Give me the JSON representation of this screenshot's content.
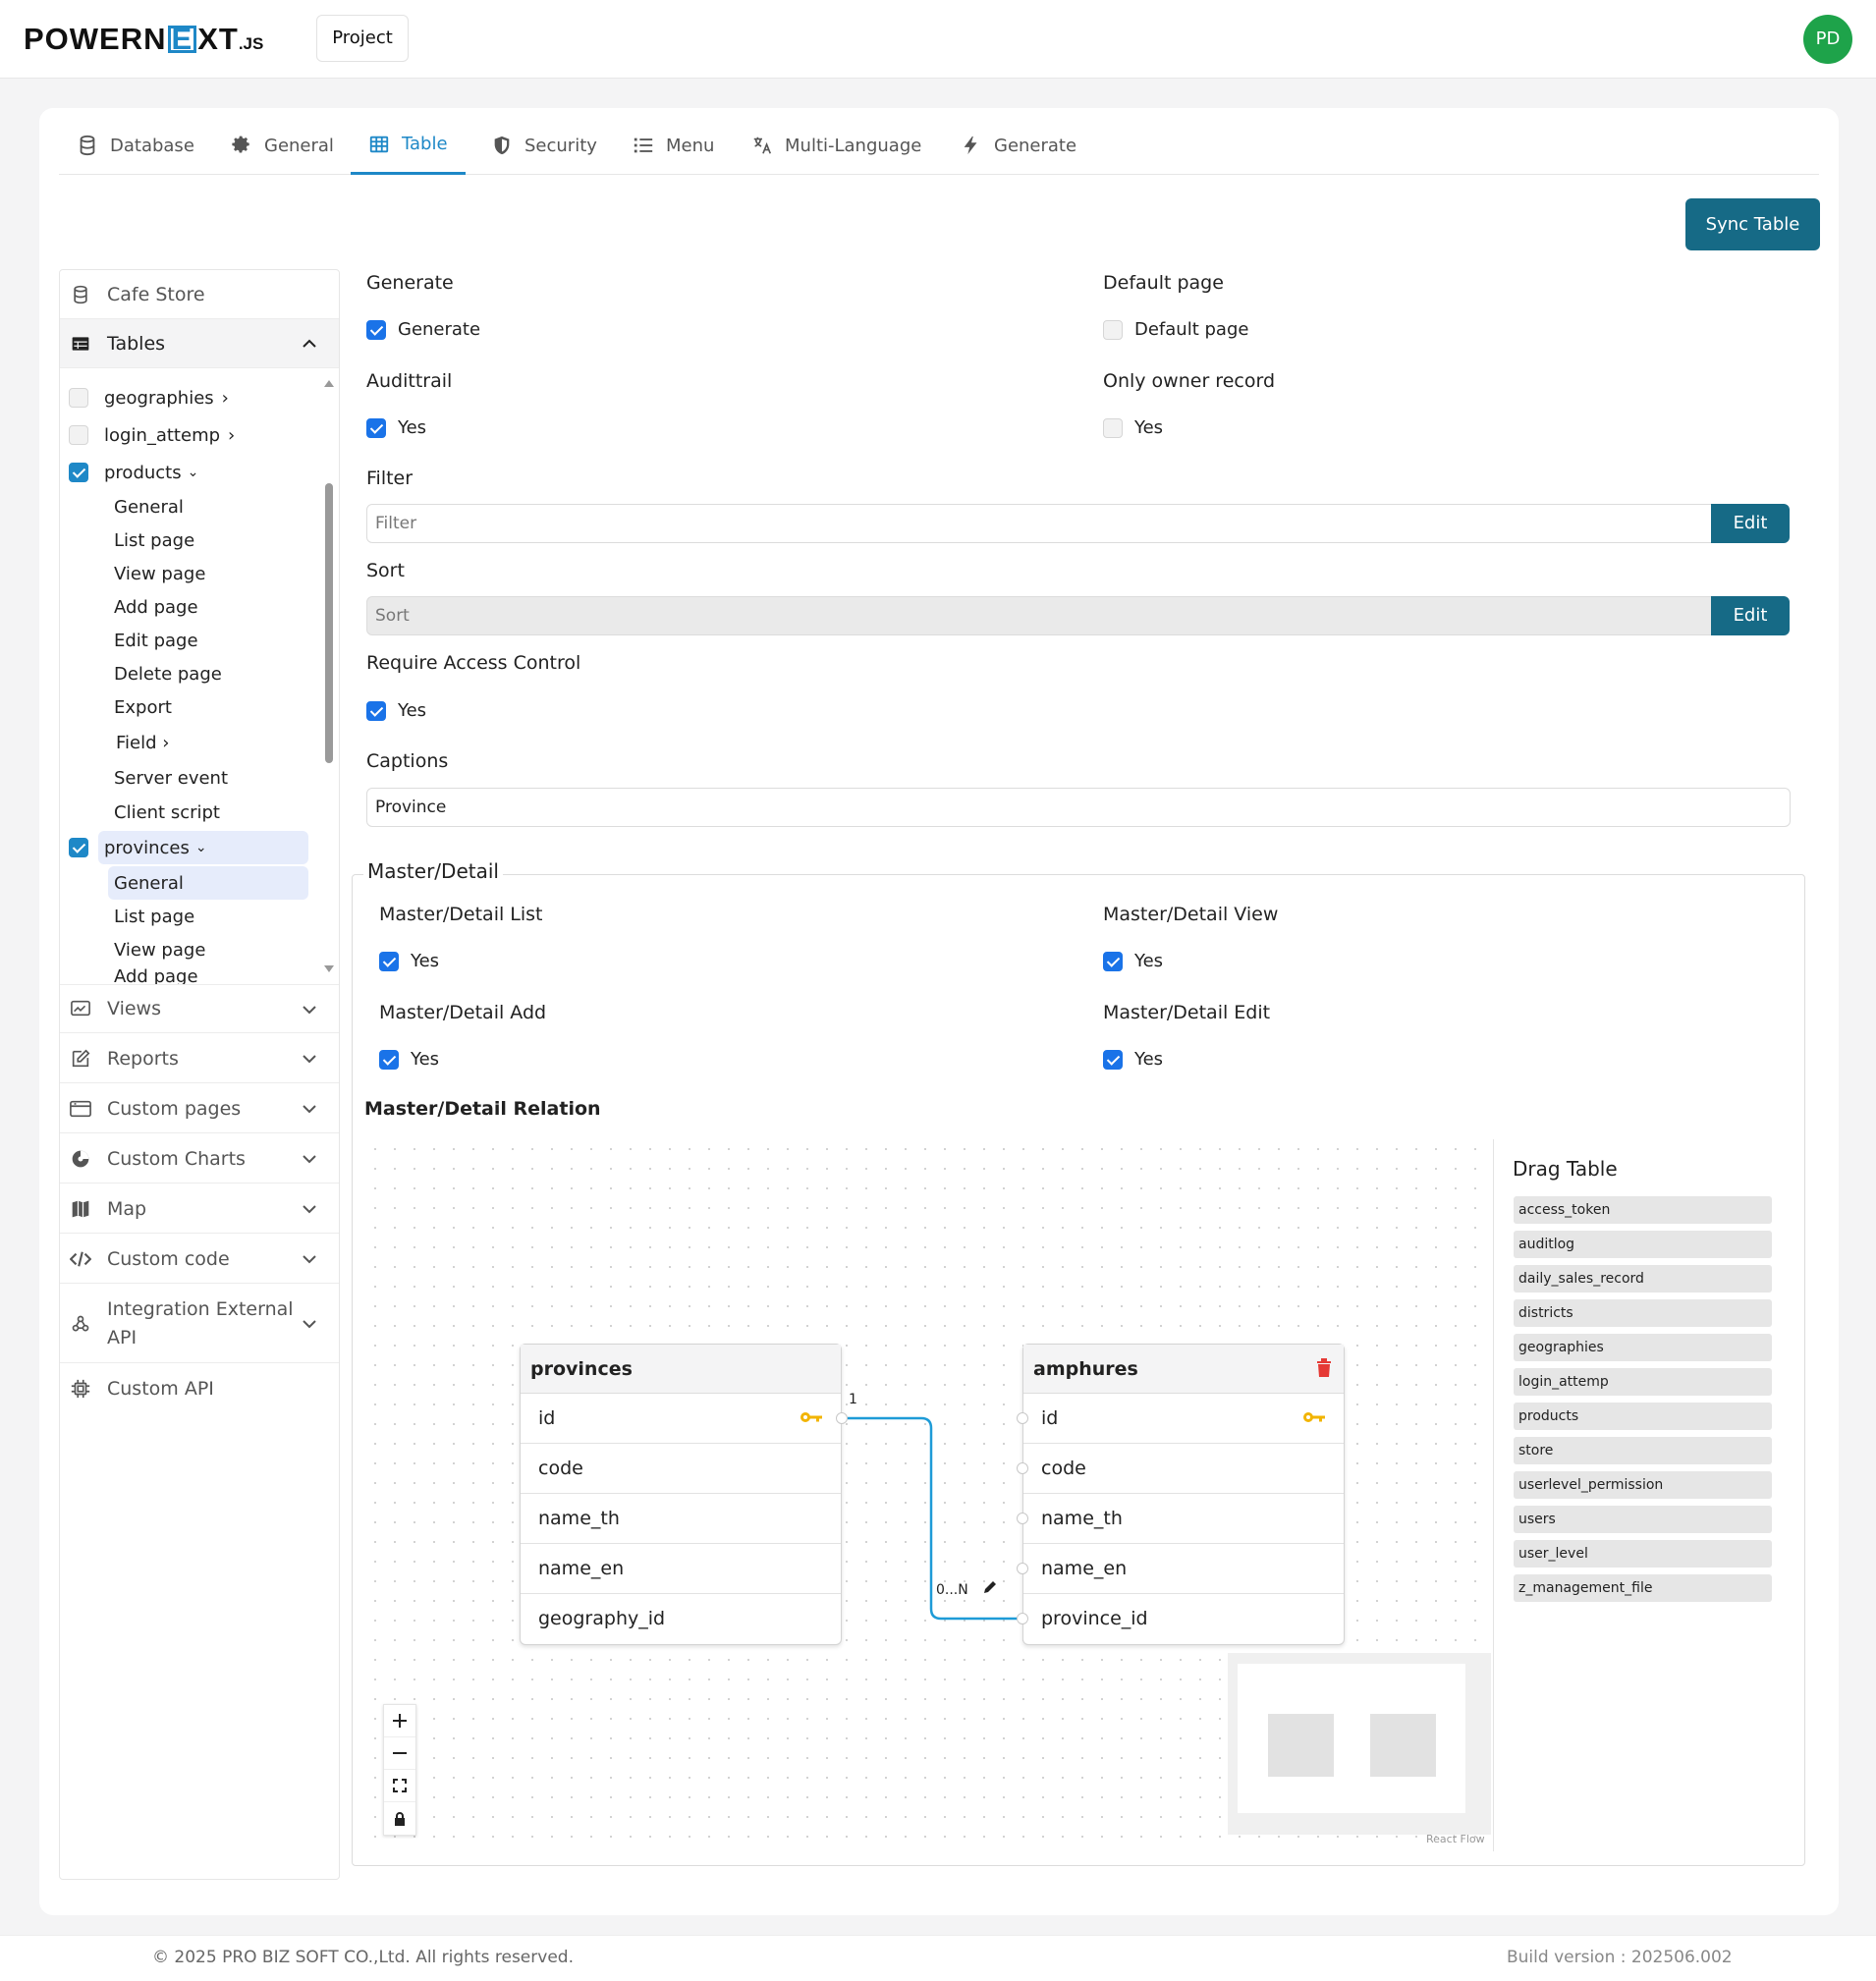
{
  "app": {
    "logo_main": "POWERN",
    "logo_e": "E",
    "logo_xt": "XT",
    "logo_js": ".JS",
    "project_label": "Project",
    "avatar_initials": "PD",
    "accent": "#166a86",
    "tab_active": "#1e88c7",
    "avatar_color": "#1ea34a"
  },
  "tabs": [
    {
      "label": "Database",
      "icon": "database-icon"
    },
    {
      "label": "General",
      "icon": "gear-icon"
    },
    {
      "label": "Table",
      "icon": "table-icon",
      "active": true
    },
    {
      "label": "Security",
      "icon": "shield-icon"
    },
    {
      "label": "Menu",
      "icon": "menu-icon"
    },
    {
      "label": "Multi-Language",
      "icon": "translate-icon"
    },
    {
      "label": "Generate",
      "icon": "bolt-icon"
    }
  ],
  "sync_label": "Sync Table",
  "sidebar": {
    "db": "Cafe Store",
    "tables": "Tables",
    "tree": [
      {
        "label": "geographies",
        "checked": false,
        "chev": "›"
      },
      {
        "label": "login_attemp",
        "checked": false,
        "chev": "›"
      },
      {
        "label": "products",
        "checked": true,
        "chev": "⌄"
      },
      {
        "label": "General"
      },
      {
        "label": "List page"
      },
      {
        "label": "View page"
      },
      {
        "label": "Add page"
      },
      {
        "label": "Edit page"
      },
      {
        "label": "Delete page"
      },
      {
        "label": "Export"
      },
      {
        "label": "Field ›"
      },
      {
        "label": "Server event"
      },
      {
        "label": "Client script"
      },
      {
        "label": "provinces",
        "checked": true,
        "chev": "⌄"
      },
      {
        "label": "General",
        "selected": true
      },
      {
        "label": "List page"
      },
      {
        "label": "View page"
      },
      {
        "label": "Add page"
      }
    ],
    "sections": [
      {
        "label": "Views",
        "icon": "views-icon"
      },
      {
        "label": "Reports",
        "icon": "edit-report-icon"
      },
      {
        "label": "Custom pages",
        "icon": "window-icon"
      },
      {
        "label": "Custom Charts",
        "icon": "chart-icon"
      },
      {
        "label": "Map",
        "icon": "map-icon"
      },
      {
        "label": "Custom code",
        "icon": "code-icon"
      },
      {
        "label": "Integration External API",
        "icon": "integration-icon"
      },
      {
        "label": "Custom API",
        "icon": "chip-icon"
      }
    ]
  },
  "form": {
    "generate_label": "Generate",
    "generate_check": "Generate",
    "default_page_label": "Default page",
    "default_page_check": "Default page",
    "audittrail_label": "Audittrail",
    "audittrail_check": "Yes",
    "owner_label": "Only owner record",
    "owner_check": "Yes",
    "filter_label": "Filter",
    "filter_placeholder": "Filter",
    "edit": "Edit",
    "sort_label": "Sort",
    "sort_placeholder": "Sort",
    "access_label": "Require Access Control",
    "access_check": "Yes",
    "captions_label": "Captions",
    "captions_value": "Province"
  },
  "master_detail": {
    "legend": "Master/Detail",
    "list_label": "Master/Detail List",
    "view_label": "Master/Detail View",
    "add_label": "Master/Detail Add",
    "edit_label": "Master/Detail Edit",
    "yes": "Yes",
    "relation_label": "Master/Detail Relation"
  },
  "diagram": {
    "left": {
      "name": "provinces",
      "fields": [
        "id",
        "code",
        "name_th",
        "name_en",
        "geography_id"
      ]
    },
    "right": {
      "name": "amphures",
      "fields": [
        "id",
        "code",
        "name_th",
        "name_en",
        "province_id"
      ]
    },
    "card_one": "1",
    "card_many": "0...N",
    "react_flow": "React Flow",
    "drag_title": "Drag Table",
    "drag_tables": [
      "access_token",
      "auditlog",
      "daily_sales_record",
      "districts",
      "geographies",
      "login_attemp",
      "products",
      "store",
      "userlevel_permission",
      "users",
      "user_level",
      "z_management_file"
    ]
  },
  "footer": {
    "copyright": "© 2025 PRO BIZ SOFT CO.,Ltd. All rights reserved.",
    "build": "Build version : 202506.002"
  }
}
